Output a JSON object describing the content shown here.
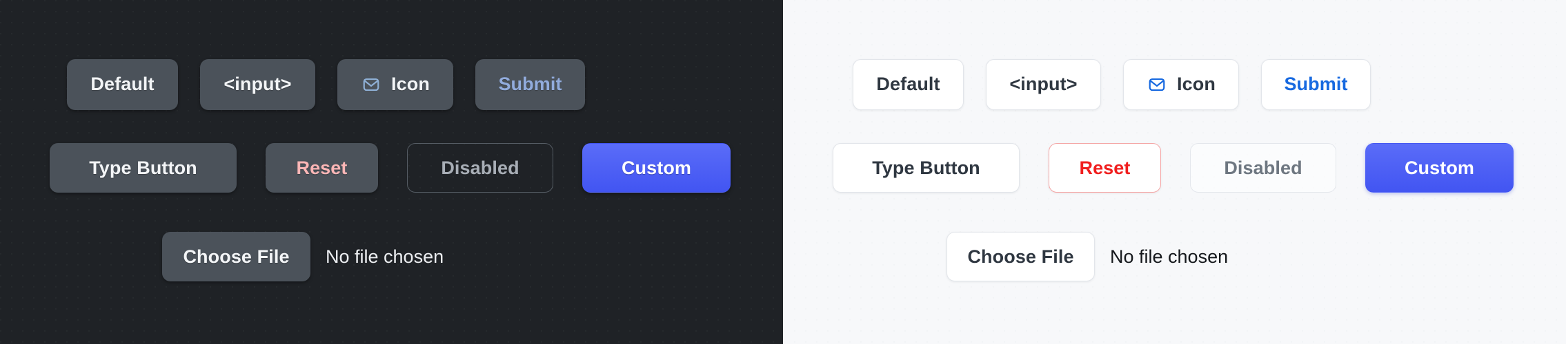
{
  "meta": {
    "panels": [
      "dark",
      "light"
    ],
    "colors": {
      "dark_bg": "#1f2226",
      "light_bg": "#f7f8fa",
      "dark_button_bg": "#4b525a",
      "light_button_bg": "#ffffff",
      "accent_custom": "#4255f2",
      "dark_submit_text": "#92acdd",
      "light_submit_text": "#1769e0",
      "dark_reset_text": "#fbb6b6",
      "light_reset_text": "#f01e1e",
      "dark_disabled_text": "#a8aeb6",
      "light_disabled_text": "#6e7781",
      "dark_icon_stroke": "#8fb0d6",
      "light_icon_stroke": "#1769e0"
    }
  },
  "buttons": {
    "row1": [
      {
        "id": "default",
        "label": "Default",
        "variant": "default"
      },
      {
        "id": "input",
        "label": "<input>",
        "variant": "default"
      },
      {
        "id": "icon",
        "label": "Icon",
        "variant": "icon",
        "icon": "envelope-icon"
      },
      {
        "id": "submit",
        "label": "Submit",
        "variant": "submit"
      }
    ],
    "row2": [
      {
        "id": "type-button",
        "label": "Type Button",
        "variant": "default"
      },
      {
        "id": "reset",
        "label": "Reset",
        "variant": "reset"
      },
      {
        "id": "disabled",
        "label": "Disabled",
        "variant": "disabled"
      },
      {
        "id": "custom",
        "label": "Custom",
        "variant": "custom"
      }
    ],
    "row3": {
      "file_button_label": "Choose File",
      "file_status_text": "No file chosen"
    }
  }
}
